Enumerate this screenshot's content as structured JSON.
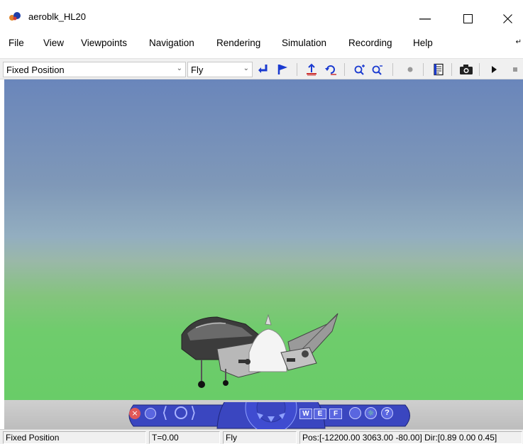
{
  "window": {
    "title": "aeroblk_HL20",
    "icon": "matlab-simulink-icon",
    "controls": [
      "minimize-icon",
      "maximize-icon",
      "close-icon"
    ]
  },
  "menu": {
    "items": [
      {
        "label": "File"
      },
      {
        "label": "View"
      },
      {
        "label": "Viewpoints"
      },
      {
        "label": "Navigation"
      },
      {
        "label": "Rendering"
      },
      {
        "label": "Simulation"
      },
      {
        "label": "Recording"
      },
      {
        "label": "Help"
      }
    ]
  },
  "toolbar": {
    "viewpoint_combo": {
      "value": "Fixed Position"
    },
    "navigation_combo": {
      "value": "Fly"
    },
    "buttons": [
      "return-to-viewpoint-icon",
      "create-viewpoint-icon",
      "straighten-up-icon",
      "undo-move-icon",
      "zoom-in-icon",
      "zoom-out-icon",
      "record-icon",
      "options-icon",
      "snapshot-icon",
      "play-icon",
      "stop-icon"
    ]
  },
  "colors": {
    "sky_top": "#6a86bb",
    "horizon": "#9ab8a8",
    "ground": "#66cc66",
    "nav_panel": "#3a46c0"
  },
  "navpanel": {
    "buttons": [
      "close-panel-icon",
      "minimize-panel-icon",
      "left-arrow-icon",
      "right-arrow-icon",
      "navigation-wheel-icon",
      "headlight-icon",
      "help-icon"
    ],
    "walk_label": "W",
    "examine_label": "E",
    "fly_label": "F",
    "help_label": "?"
  },
  "statusbar": {
    "viewpoint": "Fixed Position",
    "time": "T=0.00",
    "mode": "Fly",
    "pos_dir": "Pos:[-12200.00 3063.00 -80.00] Dir:[0.89 0.00 0.45]"
  }
}
